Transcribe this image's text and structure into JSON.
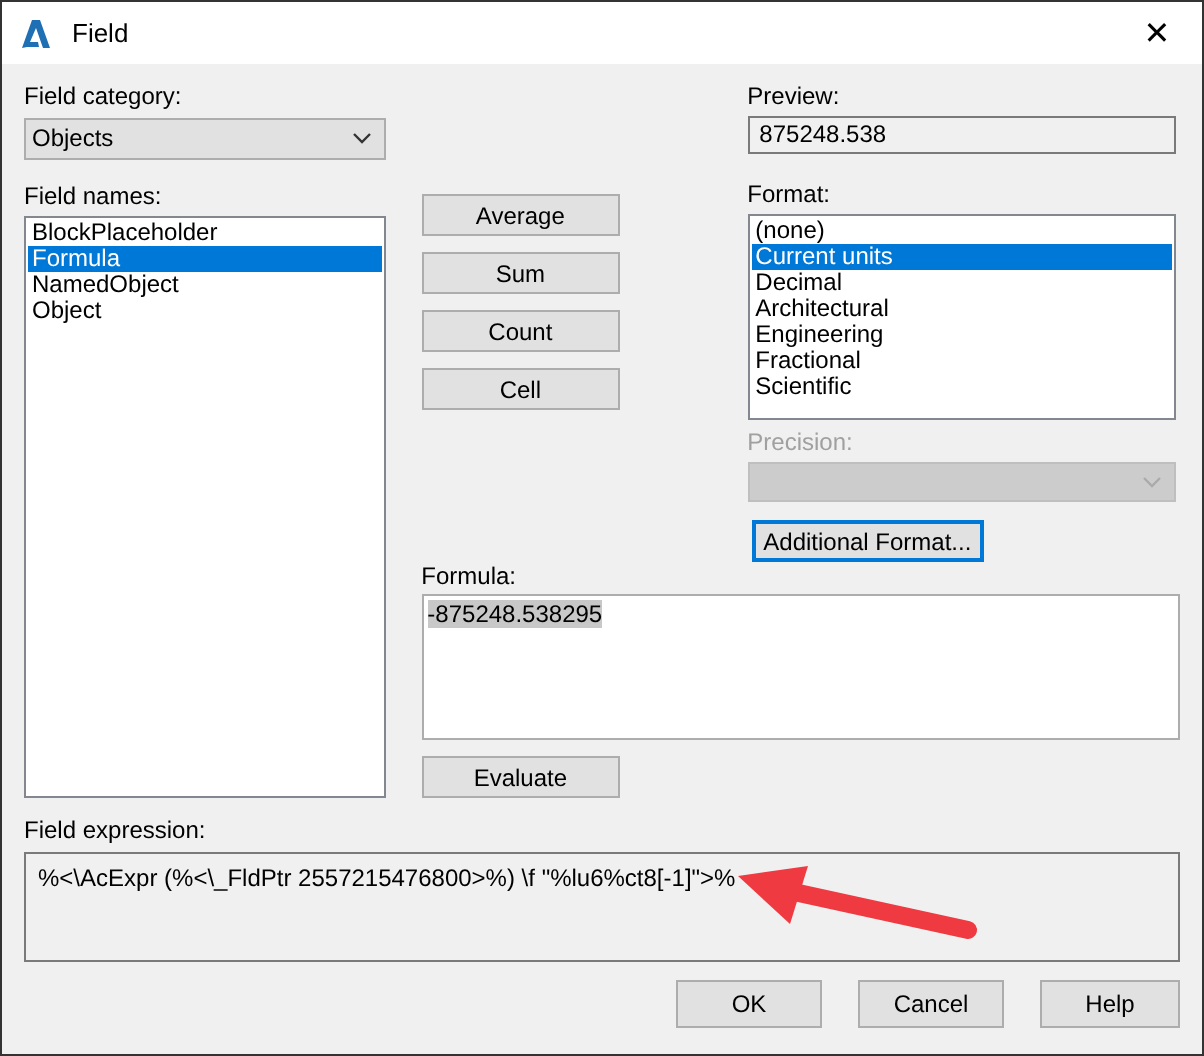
{
  "window": {
    "title": "Field",
    "close": "✕"
  },
  "field_category": {
    "label": "Field category:",
    "value": "Objects"
  },
  "field_names": {
    "label": "Field names:",
    "items": [
      {
        "label": "BlockPlaceholder",
        "selected": false
      },
      {
        "label": "Formula",
        "selected": true
      },
      {
        "label": "NamedObject",
        "selected": false
      },
      {
        "label": "Object",
        "selected": false
      }
    ]
  },
  "function_buttons": [
    "Average",
    "Sum",
    "Count",
    "Cell"
  ],
  "preview": {
    "label": "Preview:",
    "value": "875248.538"
  },
  "format": {
    "label": "Format:",
    "items": [
      {
        "label": "(none)",
        "selected": false
      },
      {
        "label": "Current units",
        "selected": true
      },
      {
        "label": "Decimal",
        "selected": false
      },
      {
        "label": "Architectural",
        "selected": false
      },
      {
        "label": "Engineering",
        "selected": false
      },
      {
        "label": "Fractional",
        "selected": false
      },
      {
        "label": "Scientific",
        "selected": false
      }
    ]
  },
  "precision": {
    "label": "Precision:",
    "disabled": true
  },
  "additional_format_button": {
    "label": "Additional Format...",
    "focused": true
  },
  "formula": {
    "label": "Formula:",
    "value": "-875248.538295",
    "selected": true
  },
  "evaluate_button": "Evaluate",
  "field_expression": {
    "label": "Field expression:",
    "value": "%<\\AcExpr (%<\\_FldPtr 2557215476800>%) \\f \"%lu6%ct8[-1]\">%"
  },
  "buttons": [
    "OK",
    "Cancel",
    "Help"
  ]
}
